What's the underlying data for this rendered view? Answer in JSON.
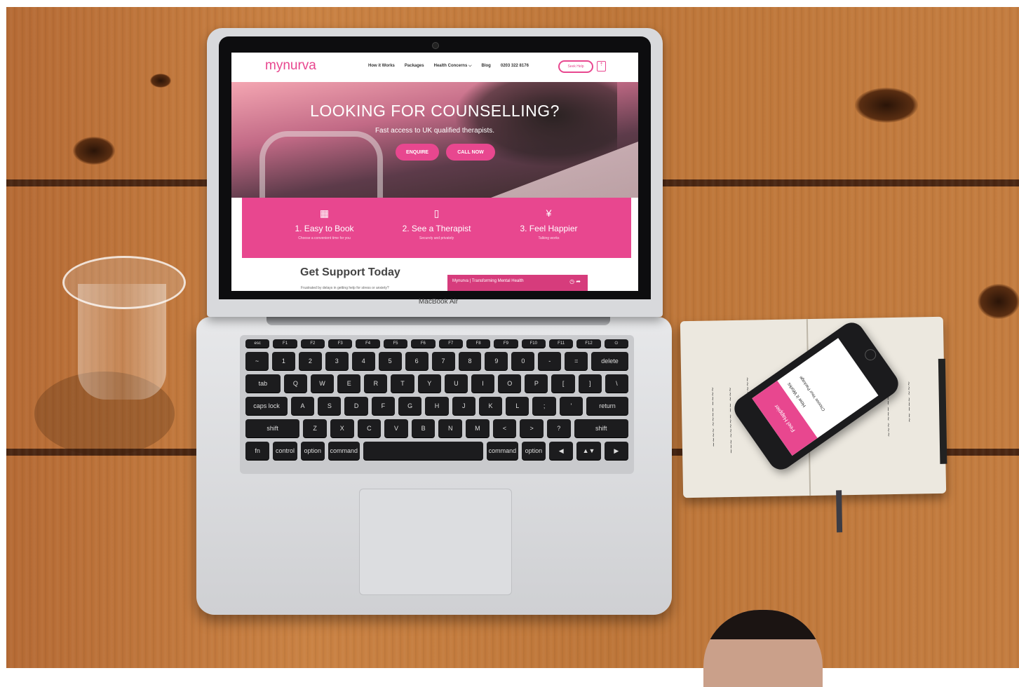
{
  "laptop": {
    "brand_label": "MacBook Air"
  },
  "website": {
    "logo": "mynurva",
    "nav": {
      "links": [
        "How it Works",
        "Packages",
        "Health Concerns ⌵",
        "Blog"
      ],
      "phone": "0203 322 8176",
      "cta": "Seek Help"
    },
    "hero": {
      "title": "LOOKING FOR COUNSELLING?",
      "subtitle": "Fast access to UK qualified therapists.",
      "btn_enquire": "ENQUIRE",
      "btn_call": "CALL NOW"
    },
    "steps": [
      {
        "icon": "calendar-icon",
        "title": "1. Easy to Book",
        "desc": "Choose a convenient time for you"
      },
      {
        "icon": "phone-icon",
        "title": "2. See a Therapist",
        "desc": "Securely and privately"
      },
      {
        "icon": "person-icon",
        "title": "3. Feel Happier",
        "desc": "Talking works"
      }
    ],
    "support": {
      "title": "Get Support Today",
      "question": "Frustrated by delays in getting help for stress or anxiety?",
      "video_title": "Mynurva | Transforming Mental Health"
    }
  },
  "phone": {
    "banner": "Feel Happier",
    "heading": "How it Works",
    "subheading": "Choose Your Package"
  },
  "colors": {
    "brand_pink": "#e8478f",
    "wood": "#c47c3e"
  }
}
